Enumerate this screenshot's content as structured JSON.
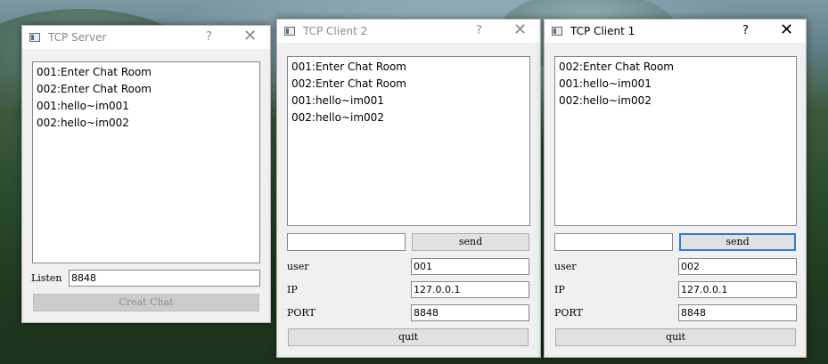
{
  "server": {
    "title": "TCP Server",
    "help_glyph": "?",
    "close_glyph": "✕",
    "messages": [
      "001:Enter Chat Room",
      "002:Enter Chat Room",
      "001:hello~im001",
      "002:hello~im002"
    ],
    "listen_label": "Listen",
    "listen_value": "8848",
    "create_button": "Creat Chat"
  },
  "client2": {
    "title": "TCP Client 2",
    "help_glyph": "?",
    "close_glyph": "✕",
    "messages": [
      "001:Enter Chat Room",
      "002:Enter Chat Room",
      "001:hello~im001",
      "002:hello~im002"
    ],
    "send_value": "",
    "send_button": "send",
    "user_label": "user",
    "user_value": "001",
    "ip_label": "IP",
    "ip_value": "127.0.0.1",
    "port_label": "PORT",
    "port_value": "8848",
    "quit_button": "quit"
  },
  "client1": {
    "title": "TCP Client 1",
    "help_glyph": "?",
    "close_glyph": "✕",
    "messages": [
      "002:Enter Chat Room",
      "001:hello~im001",
      "002:hello~im002"
    ],
    "send_value": "",
    "send_button": "send",
    "user_label": "user",
    "user_value": "002",
    "ip_label": "IP",
    "ip_value": "127.0.0.1",
    "port_label": "PORT",
    "port_value": "8848",
    "quit_button": "quit"
  },
  "colors": {
    "focus_border": "#2f7bd1",
    "window_bg": "#f0f0f0",
    "titlebar_bg": "#ffffff"
  },
  "icons": [
    "app-window-icon",
    "help-icon",
    "close-icon"
  ]
}
